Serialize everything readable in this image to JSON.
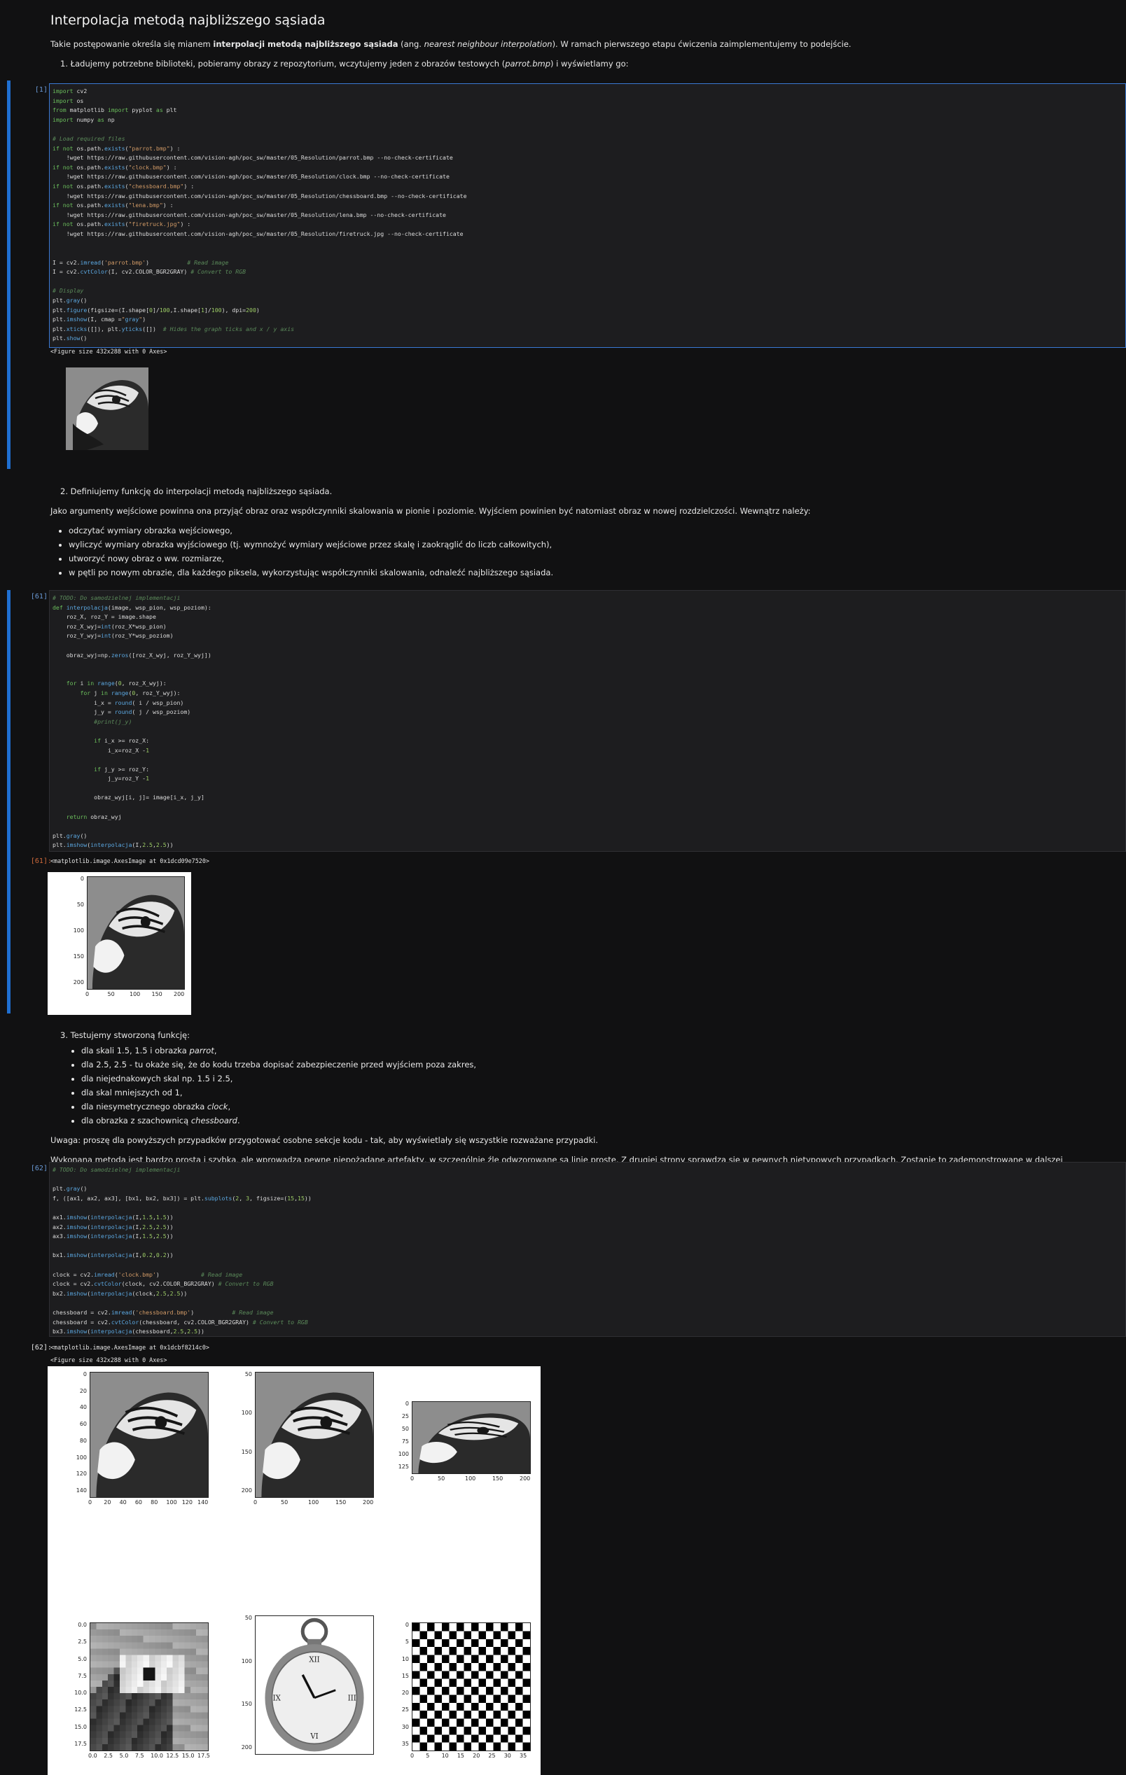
{
  "heading": "Interpolacja metodą najbliższego sąsiada",
  "intro": {
    "before": "Takie postępowanie określa się mianem ",
    "bold": "interpolacji metodą najbliższego sąsiada",
    "mid": " (ang. ",
    "italic": "nearest neighbour interpolation",
    "after": "). W ramach pierwszego etapu ćwiczenia zaimplementujemy to podejście."
  },
  "step1": {
    "num": "1.",
    "before": "Ładujemy potrzebne biblioteki, pobieramy obrazy z repozytorium, wczytujemy jeden z obrazów testowych (",
    "italic": "parrot.bmp",
    "after": ") i wyświetlamy go:"
  },
  "cell1": {
    "prompt": "[1]:",
    "code_lines": [
      "import cv2",
      "import os",
      "from matplotlib import pyplot as plt",
      "import numpy as np",
      "",
      "# Load required files",
      "if not os.path.exists(\"parrot.bmp\") :",
      "    !wget https://raw.githubusercontent.com/vision-agh/poc_sw/master/05_Resolution/parrot.bmp --no-check-certificate",
      "if not os.path.exists(\"clock.bmp\") :",
      "    !wget https://raw.githubusercontent.com/vision-agh/poc_sw/master/05_Resolution/clock.bmp --no-check-certificate",
      "if not os.path.exists(\"chessboard.bmp\") :",
      "    !wget https://raw.githubusercontent.com/vision-agh/poc_sw/master/05_Resolution/chessboard.bmp --no-check-certificate",
      "if not os.path.exists(\"lena.bmp\") :",
      "    !wget https://raw.githubusercontent.com/vision-agh/poc_sw/master/05_Resolution/lena.bmp --no-check-certificate",
      "if not os.path.exists(\"firetruck.jpg\") :",
      "    !wget https://raw.githubusercontent.com/vision-agh/poc_sw/master/05_Resolution/firetruck.jpg --no-check-certificate",
      "",
      "",
      "I = cv2.imread('parrot.bmp')           # Read image",
      "I = cv2.cvtColor(I, cv2.COLOR_BGR2GRAY) # Convert to RGB",
      "",
      "# Display",
      "plt.gray()",
      "plt.figure(figsize=(I.shape[0]/100,I.shape[1]/100), dpi=200)",
      "plt.imshow(I, cmap =\"gray\")",
      "plt.xticks([]), plt.yticks([])  # Hides the graph ticks and x / y axis",
      "plt.show()"
    ],
    "output_text": "<Figure size 432x288 with 0 Axes>"
  },
  "step2": {
    "num": "2.",
    "text": "Definiujemy funkcję do interpolacji metodą najbliższego sąsiada.",
    "desc": "Jako argumenty wejściowe powinna ona przyjąć obraz oraz współczynniki skalowania w pionie i poziomie. Wyjściem powinien być natomiast obraz w nowej rozdzielczości. Wewnątrz należy:",
    "bullets": [
      "odczytać wymiary obrazka wejściowego,",
      "wyliczyć wymiary obrazka wyjściowego (tj. wymnożyć wymiary wejściowe przez skalę i zaokrąglić do liczb całkowitych),",
      "utworzyć nowy obraz o ww. rozmiarze,",
      "w pętli po nowym obrazie, dla każdego piksela, wykorzystując współczynniki skalowania, odnaleźć najbliższego sąsiada."
    ]
  },
  "cell2": {
    "prompt": "[61]:",
    "out_prompt": "[61]:",
    "code_lines": [
      "# TODO: Do samodzielnej implementacji",
      "def interpolacja(image, wsp_pion, wsp_poziom):",
      "    roz_X, roz_Y = image.shape",
      "    roz_X_wyj=int(roz_X*wsp_pion)",
      "    roz_Y_wyj=int(roz_Y*wsp_poziom)",
      "",
      "    obraz_wyj=np.zeros([roz_X_wyj, roz_Y_wyj])",
      "",
      "",
      "    for i in range(0, roz_X_wyj):",
      "        for j in range(0, roz_Y_wyj):",
      "            i_x = round( i / wsp_pion)",
      "            j_y = round( j / wsp_poziom)",
      "            #print(j_y)",
      "",
      "            if i_x >= roz_X:",
      "                i_x=roz_X -1",
      "",
      "            if j_y >= roz_Y:",
      "                j_y=roz_Y -1",
      "",
      "            obraz_wyj[i, j]= image[i_x, j_y]",
      "",
      "    return obraz_wyj",
      "",
      "plt.gray()",
      "plt.imshow(interpolacja(I,2.5,2.5))"
    ],
    "output_text": "<matplotlib.image.AxesImage at 0x1dcd09e7520>",
    "axes": {
      "yticks": [
        "0",
        "50",
        "100",
        "150",
        "200"
      ],
      "xticks": [
        "0",
        "50",
        "100",
        "150",
        "200"
      ]
    }
  },
  "step3": {
    "num": "3.",
    "text": "Testujemy stworzoną funkcję:",
    "bullets": [
      {
        "before": "dla skali 1.5, 1.5 i obrazka ",
        "italic": "parrot",
        "after": ","
      },
      {
        "before": "dla 2.5, 2.5 - tu okaże się, że do kodu trzeba dopisać zabezpieczenie przed wyjściem poza zakres,",
        "italic": "",
        "after": ""
      },
      {
        "before": "dla niejednakowych skal np. 1.5 i 2.5,",
        "italic": "",
        "after": ""
      },
      {
        "before": "dla skal mniejszych od 1,",
        "italic": "",
        "after": ""
      },
      {
        "before": "dla niesymetrycznego obrazka ",
        "italic": "clock",
        "after": ","
      },
      {
        "before": "dla obrazka z szachownicą ",
        "italic": "chessboard",
        "after": "."
      }
    ],
    "note": "Uwaga: proszę dla powyższych przypadków przygotować osobne sekcje kodu - tak, aby wyświetlały się wszystkie rozważane przypadki.",
    "summary": "Wykonana metoda jest bardzo prosta i szybka, ale wprowadza pewne niepożądane artefakty, w szczególnie źle odwzorowane są linie proste. Z drugiej strony sprawdza się w pewnych nietypowych przypadkach. Zostanie to zademonstrowane w dalszej części ćwiczenia."
  },
  "cell3": {
    "prompt": "[62]:",
    "out_prompt": "[62]:",
    "code_lines": [
      "# TODO: Do samodzielnej implementacji",
      "",
      "plt.gray()",
      "f, ([ax1, ax2, ax3], [bx1, bx2, bx3]) = plt.subplots(2, 3, figsize=(15,15))",
      "",
      "ax1.imshow(interpolacja(I,1.5,1.5))",
      "ax2.imshow(interpolacja(I,2.5,2.5))",
      "ax3.imshow(interpolacja(I,1.5,2.5))",
      "",
      "bx1.imshow(interpolacja(I,0.2,0.2))",
      "",
      "clock = cv2.imread('clock.bmp')            # Read image",
      "clock = cv2.cvtColor(clock, cv2.COLOR_BGR2GRAY) # Convert to RGB",
      "bx2.imshow(interpolacja(clock,2.5,2.5))",
      "",
      "chessboard = cv2.imread('chessboard.bmp')           # Read image",
      "chessboard = cv2.cvtColor(chessboard, cv2.COLOR_BGR2GRAY) # Convert to RGB",
      "bx3.imshow(interpolacja(chessboard,2.5,2.5))"
    ],
    "output_text_1": "<matplotlib.image.AxesImage at 0x1dcbf8214c0>",
    "output_text_2": "<Figure size 432x288 with 0 Axes>",
    "subplots": {
      "ax1": {
        "yticks": [
          "0",
          "20",
          "40",
          "60",
          "80",
          "100",
          "120",
          "140"
        ],
        "xticks": [
          "0",
          "20",
          "40",
          "60",
          "80",
          "100",
          "120",
          "140"
        ]
      },
      "ax2": {
        "yticks": [
          "50",
          "100",
          "150",
          "200"
        ],
        "xticks": [
          "0",
          "50",
          "100",
          "150",
          "200"
        ]
      },
      "ax3": {
        "yticks": [
          "0",
          "25",
          "50",
          "75",
          "100",
          "125"
        ],
        "xticks": [
          "0",
          "50",
          "100",
          "150",
          "200"
        ]
      },
      "bx1": {
        "yticks": [
          "0.0",
          "2.5",
          "5.0",
          "7.5",
          "10.0",
          "12.5",
          "15.0",
          "17.5"
        ],
        "xticks": [
          "0.0",
          "2.5",
          "5.0",
          "7.5",
          "10.0",
          "12.5",
          "15.0",
          "17.5"
        ]
      },
      "bx2": {
        "yticks": [
          "50",
          "100",
          "150",
          "200"
        ],
        "xticks": []
      },
      "bx3": {
        "yticks": [
          "0",
          "5",
          "10",
          "15",
          "20",
          "25",
          "30",
          "35"
        ],
        "xticks": [
          "0",
          "5",
          "10",
          "15",
          "20",
          "25",
          "30",
          "35"
        ]
      }
    }
  },
  "colors": {
    "background": "#111112",
    "cell_bar": "#1f6fd1",
    "code_bg": "#1d1d1f",
    "in_prompt": "#6a9ad6",
    "out_prompt": "#d06a3b"
  }
}
